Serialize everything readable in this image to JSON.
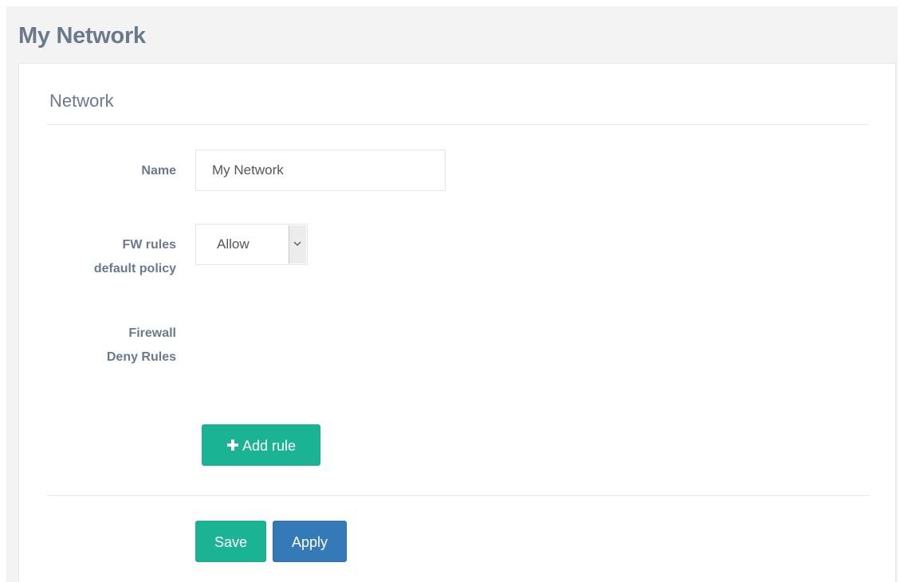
{
  "page": {
    "title": "My Network"
  },
  "section": {
    "title": "Network"
  },
  "form": {
    "name_label": "Name",
    "name_value": "My Network",
    "fw_label_line1": "FW rules",
    "fw_label_line2": "default policy",
    "fw_selected": "Allow",
    "deny_label_line1": "Firewall",
    "deny_label_line2": "Deny Rules",
    "add_rule_label": "Add rule"
  },
  "actions": {
    "save_label": "Save",
    "apply_label": "Apply"
  },
  "icons": {
    "add": "plus-icon",
    "select": "chevron-down-icon"
  },
  "colors": {
    "title": "#6a7a8c",
    "primary_green": "#1ab394",
    "primary_blue": "#337ab7",
    "background": "#f3f3f4"
  }
}
